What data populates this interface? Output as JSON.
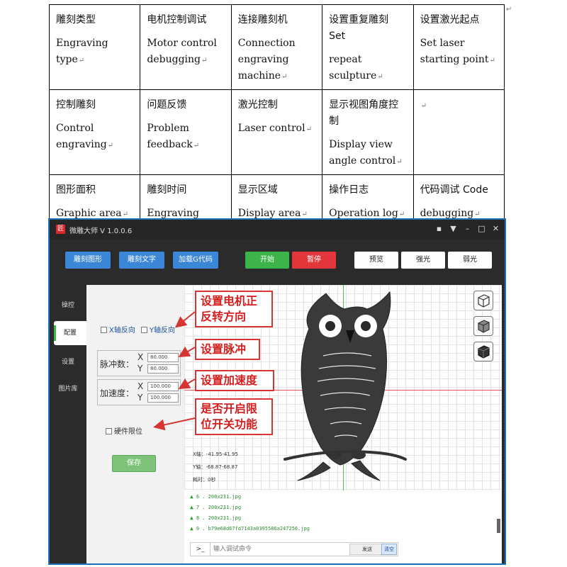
{
  "table": {
    "rows": [
      [
        {
          "cn": "雕刻类型",
          "en": "Engraving type"
        },
        {
          "cn": "电机控制调试",
          "en": "Motor control debugging"
        },
        {
          "cn": "连接雕刻机",
          "en": "Connection engraving machine"
        },
        {
          "cn": "设置重复雕刻 Set",
          "en": "repeat sculpture"
        },
        {
          "cn": "设置激光起点",
          "en": "Set laser starting point"
        }
      ],
      [
        {
          "cn": "控制雕刻",
          "en": "Control engraving"
        },
        {
          "cn": "问题反馈",
          "en": "Problem feedback"
        },
        {
          "cn": "激光控制",
          "en": "Laser control"
        },
        {
          "cn": "显示视图角度控制",
          "en": "Display view angle control"
        },
        {
          "cn": "",
          "en": ""
        }
      ],
      [
        {
          "cn": "图形面积",
          "en": "Graphic area"
        },
        {
          "cn": "雕刻时间",
          "en": "Engraving time"
        },
        {
          "cn": "显示区域",
          "en": "Display area"
        },
        {
          "cn": "操作日志",
          "en": "Operation log"
        },
        {
          "cn": "代码调试 Code",
          "en": "debugging"
        }
      ]
    ],
    "return_mark": "↵"
  },
  "app": {
    "logo": "匠",
    "title": "微雕大师 V 1.0.0.6",
    "window_icons": [
      "chat-icon",
      "down-arrow-icon",
      "minimize-icon",
      "maximize-icon",
      "close-icon"
    ],
    "toolbar": {
      "engrave_shape": "雕刻图形",
      "engrave_text": "雕刻文字",
      "load_gcode": "加载G代码",
      "start": "开始",
      "pause": "暂停",
      "preview": "预览",
      "strong_light": "强光",
      "weak_light": "弱光"
    },
    "nav": [
      "操控",
      "配置",
      "设置",
      "图片库"
    ],
    "nav_active": "配置",
    "panel": {
      "x_reverse": "X轴反向",
      "y_reverse": "Y轴反向",
      "pulse_label": "脉冲数：",
      "pulse_x": "80.000",
      "pulse_y": "80.000",
      "accel_label": "加速度：",
      "accel_x": "100.000",
      "accel_y": "100.000",
      "axis_x": "X",
      "axis_y": "Y",
      "hw_limit": "硬件限位",
      "save": "保存"
    },
    "readout": {
      "x": "X轴：-41.95-41.95",
      "y": "Y轴：-68.87-68.87",
      "time": "耗时：0秒"
    },
    "log": [
      "6 . 200x231.jpg",
      "7 . 200x231.jpg",
      "8 . 200x231.jpg",
      "9 . b79e68d67fd7143a0395586a247256.jpg"
    ],
    "cmd": {
      "prompt": ">_",
      "placeholder": "输入调试命令",
      "send": "发送",
      "clear": "清空"
    },
    "callouts": {
      "motor_dir": "设置电机正\n反转方向",
      "pulse": "设置脉冲",
      "accel": "设置加速度",
      "limit": "是否开启限\n位开关功能"
    },
    "colors": {
      "accent_blue": "#3b86d6",
      "start_green": "#3db44a",
      "pause_red": "#e2363b",
      "callout_red": "#d21f1f"
    }
  }
}
